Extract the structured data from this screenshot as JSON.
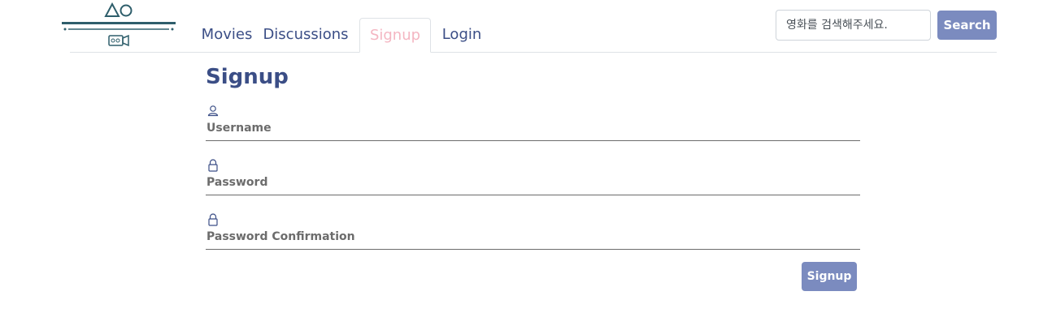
{
  "logo": {
    "icon": "triangle-circle-camera-logo"
  },
  "nav": {
    "tabs": [
      {
        "label": "Movies",
        "active": false
      },
      {
        "label": "Discussions",
        "active": false
      },
      {
        "label": "Signup",
        "active": true
      },
      {
        "label": "Login",
        "active": false
      }
    ]
  },
  "search": {
    "placeholder": "영화를 검색해주세요.",
    "value": "",
    "button_label": "Search"
  },
  "form": {
    "title": "Signup",
    "fields": [
      {
        "icon": "user-icon",
        "placeholder": "Username",
        "value": ""
      },
      {
        "icon": "lock-icon",
        "placeholder": "Password",
        "value": ""
      },
      {
        "icon": "lock-icon",
        "placeholder": "Password Confirmation",
        "value": ""
      }
    ],
    "submit_label": "Signup"
  },
  "colors": {
    "primary": "#3b4e86",
    "button": "#7b8bbf",
    "active_tab": "#f4b6c2",
    "logo": "#2e5e6b"
  }
}
